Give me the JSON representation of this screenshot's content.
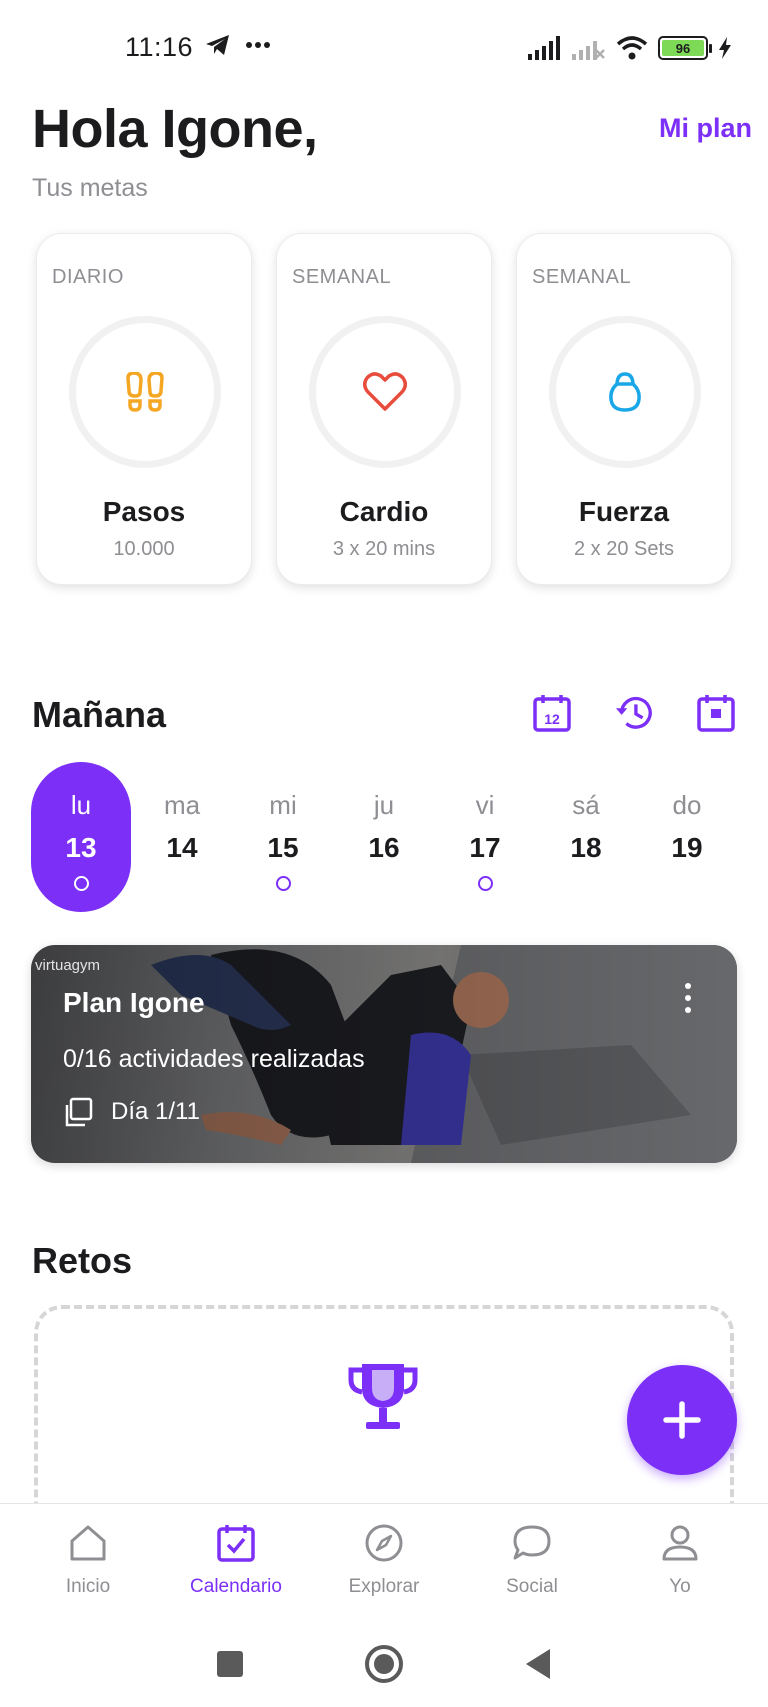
{
  "status_bar": {
    "time": "11:16",
    "battery": "96",
    "icons": [
      "telegram-icon",
      "more-icon",
      "signal-icon",
      "signal-off-icon",
      "wifi-icon",
      "battery-icon",
      "charging-icon"
    ]
  },
  "header": {
    "greeting": "Hola Igone,",
    "subtitle": "Tus metas",
    "plan_link": "Mi plan"
  },
  "goals": [
    {
      "period": "DIARIO",
      "name": "Pasos",
      "target": "10.000",
      "icon": "footsteps-icon",
      "color": "#f5a623"
    },
    {
      "period": "SEMANAL",
      "name": "Cardio",
      "target": "3 x 20 mins",
      "icon": "heart-icon",
      "color": "#e74c3c"
    },
    {
      "period": "SEMANAL",
      "name": "Fuerza",
      "target": "2 x 20 Sets",
      "icon": "kettlebell-icon",
      "color": "#1aa7e8"
    }
  ],
  "tomorrow": {
    "title": "Mañana",
    "tools": [
      "calendar-day-icon",
      "history-icon",
      "calendar-today-icon"
    ],
    "calendar_badge": "12",
    "days": [
      {
        "name": "lu",
        "num": "13",
        "selected": true,
        "dot": true
      },
      {
        "name": "ma",
        "num": "14",
        "selected": false,
        "dot": false
      },
      {
        "name": "mi",
        "num": "15",
        "selected": false,
        "dot": true
      },
      {
        "name": "ju",
        "num": "16",
        "selected": false,
        "dot": false
      },
      {
        "name": "vi",
        "num": "17",
        "selected": false,
        "dot": true
      },
      {
        "name": "sá",
        "num": "18",
        "selected": false,
        "dot": false
      },
      {
        "name": "do",
        "num": "19",
        "selected": false,
        "dot": false
      }
    ]
  },
  "plan": {
    "brand": "virtuagym",
    "title": "Plan Igone",
    "progress": "0/16 actividades realizadas",
    "day": "Día 1/11"
  },
  "challenges": {
    "title": "Retos"
  },
  "nav": {
    "items": [
      {
        "label": "Inicio",
        "icon": "home-icon",
        "active": false
      },
      {
        "label": "Calendario",
        "icon": "calendar-check-icon",
        "active": true
      },
      {
        "label": "Explorar",
        "icon": "compass-icon",
        "active": false
      },
      {
        "label": "Social",
        "icon": "chat-icon",
        "active": false
      },
      {
        "label": "Yo",
        "icon": "user-icon",
        "active": false
      }
    ]
  },
  "colors": {
    "accent": "#7b2ff7",
    "text": "#1c1c1e",
    "muted": "#8e8e93"
  }
}
